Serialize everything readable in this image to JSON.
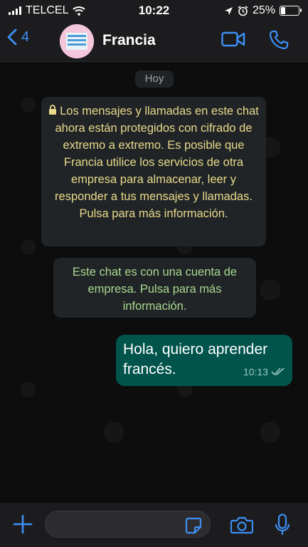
{
  "status_bar": {
    "carrier": "TELCEL",
    "time": "10:22",
    "battery_percent": "25%",
    "battery_level": 0.25,
    "icons": [
      "signal-icon",
      "wifi-icon",
      "location-arrow-icon",
      "alarm-icon",
      "battery-icon"
    ]
  },
  "header": {
    "back_count": "4",
    "contact_name": "Francia",
    "icons": [
      "back-chevron-icon",
      "video-call-icon",
      "phone-call-icon"
    ]
  },
  "chat": {
    "date_label": "Hoy",
    "encryption_notice": "Los mensajes y llamadas en este chat ahora están protegidos con cifrado de extremo a extremo. Es posible que Francia utilice los servicios de otra empresa para almacenar, leer y responder a tus mensajes y llamadas. Pulsa para más información.",
    "business_notice": "Este chat es con una cuenta de empresa. Pulsa para más información.",
    "messages": [
      {
        "direction": "outgoing",
        "text": "Hola, quiero aprender francés.",
        "time": "10:13",
        "status": "read"
      }
    ]
  },
  "input_bar": {
    "value": "",
    "icons": [
      "plus-icon",
      "sticker-icon",
      "camera-icon",
      "microphone-icon"
    ]
  },
  "colors": {
    "accent": "#3d8ff5",
    "outgoing_bubble": "#00544b",
    "encryption_text": "#e9d98a",
    "business_text": "#a9d98f"
  }
}
